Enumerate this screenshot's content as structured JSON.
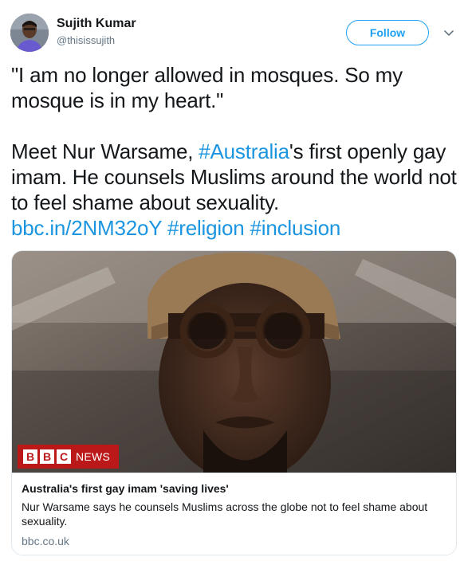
{
  "author": {
    "name": "Sujith Kumar",
    "handle": "@thisissujith"
  },
  "follow_label": "Follow",
  "tweet": {
    "line1": "\"I am no longer allowed in mosques. So my mosque is in my heart.\"",
    "text_before": "Meet Nur Warsame, ",
    "hashtag_australia": "#Australia",
    "text_after": "'s first openly gay imam. He counsels Muslims around the world not to feel shame about sexuality.",
    "short_link": "bbc.in/2NM32oY",
    "hashtag_religion": "#religion",
    "hashtag_inclusion": "#inclusion"
  },
  "card": {
    "logo_letters": [
      "B",
      "B",
      "C"
    ],
    "logo_news": "NEWS",
    "title": "Australia's first gay imam 'saving lives'",
    "description": "Nur Warsame says he counsels Muslims across the globe not to feel shame about sexuality.",
    "domain": "bbc.co.uk"
  },
  "icons": {
    "caret": "chevron-down-icon"
  },
  "colors": {
    "link": "#1b95e0",
    "follow": "#1da1f2",
    "bbc_red": "#bb1919",
    "muted": "#657786"
  }
}
